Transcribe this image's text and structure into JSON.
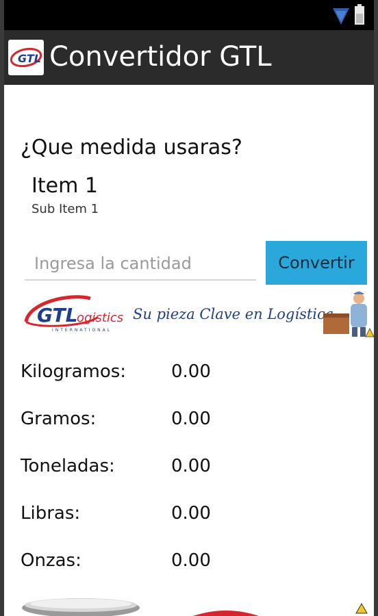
{
  "app": {
    "title": "Convertidor GTL",
    "logo_text": "GTL"
  },
  "form": {
    "question": "¿Que medida usaras?",
    "spinner": {
      "title": "Item 1",
      "subtitle": "Sub Item 1"
    },
    "quantity_placeholder": "Ingresa la cantidad",
    "quantity_value": "",
    "convert_label": "Convertir"
  },
  "banner": {
    "logo_text": "GTLogistics",
    "logo_subtext": "INTERNATIONAL",
    "slogan": "Su pieza Clave en Logística"
  },
  "results": [
    {
      "label": "Kilogramos:",
      "value": "0.00"
    },
    {
      "label": "Gramos:",
      "value": "0.00"
    },
    {
      "label": "Toneladas:",
      "value": "0.00"
    },
    {
      "label": "Libras:",
      "value": "0.00"
    },
    {
      "label": "Onzas:",
      "value": "0.00"
    }
  ],
  "icons": {
    "wifi": "wifi-signal-icon",
    "battery": "battery-icon",
    "warning": "warning-icon"
  },
  "colors": {
    "action_bar": "#2b2b2b",
    "accent": "#2aa8dc",
    "brand_red": "#d8262e",
    "brand_blue": "#1e3f8f"
  }
}
